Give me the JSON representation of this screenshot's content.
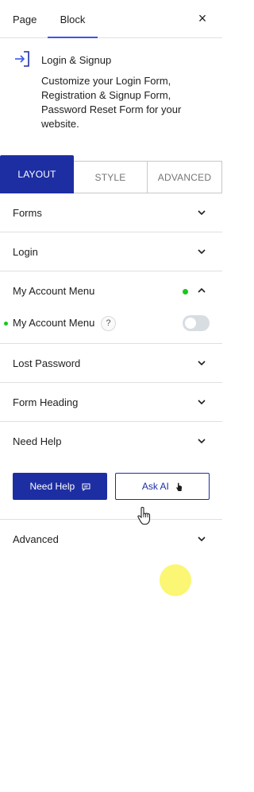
{
  "top_tabs": {
    "page": "Page",
    "block": "Block",
    "close": "×"
  },
  "block_card": {
    "title": "Login & Signup",
    "description": "Customize your Login Form, Registration & Signup Form, Password Reset Form for your website."
  },
  "style_tabs": {
    "layout": "LAYOUT",
    "style": "STYLE",
    "advanced": "ADVANCED",
    "active": "LAYOUT"
  },
  "panels": {
    "forms": "Forms",
    "login": "Login",
    "my_account_menu": "My Account Menu",
    "lost_password": "Lost Password",
    "form_heading": "Form Heading",
    "need_help": "Need Help",
    "advanced": "Advanced"
  },
  "my_account_sub": {
    "label": "My Account Menu",
    "help": "?",
    "toggle_on": false
  },
  "buttons": {
    "need_help": "Need Help",
    "ask_ai": "Ask AI"
  },
  "colors": {
    "primary": "#1d2ea3",
    "accent": "#3858e9",
    "status_dot": "#19c819",
    "highlight": "#faf55a"
  }
}
